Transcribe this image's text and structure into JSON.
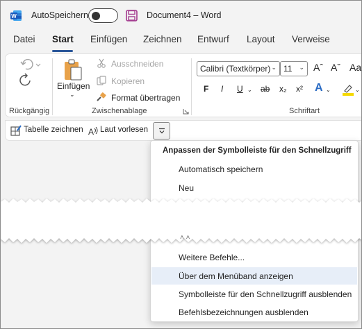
{
  "titlebar": {
    "autosave_label": "AutoSpeichern",
    "doc_title": "Document4 – Word"
  },
  "tabs": [
    {
      "label": "Datei"
    },
    {
      "label": "Start"
    },
    {
      "label": "Einfügen"
    },
    {
      "label": "Zeichnen"
    },
    {
      "label": "Entwurf"
    },
    {
      "label": "Layout"
    },
    {
      "label": "Verweise"
    }
  ],
  "ribbon": {
    "undo_group_label": "Rückgängig",
    "paste_label": "Einfügen",
    "cut_label": "Ausschneiden",
    "copy_label": "Kopieren",
    "format_painter_label": "Format übertragen",
    "clipboard_group_label": "Zwischenablage",
    "font_name": "Calibri (Textkörper)",
    "font_size": "11",
    "font_group_label": "Schriftart",
    "grow_font": "Aˆ",
    "shrink_font": "Aˇ",
    "change_case": "Aa",
    "bold": "F",
    "italic": "I",
    "underline": "U",
    "strikethrough": "ab",
    "subscript": "x₂",
    "superscript": "x²",
    "text_effects": "A"
  },
  "qat": {
    "draw_table_label": "Tabelle zeichnen",
    "read_aloud_label": "Laut vorlesen"
  },
  "menu": {
    "header": "Anpassen der Symbolleiste für den Schnellzugriff",
    "items_top": [
      {
        "label": "Automatisch speichern"
      },
      {
        "label": "Neu"
      }
    ],
    "items_bottom": [
      {
        "label": "Weitere Befehle..."
      },
      {
        "label": "Über dem Menüband anzeigen"
      },
      {
        "label": "Symbolleiste für den Schnellzugriff ausblenden"
      },
      {
        "label": "Befehlsbezeichnungen ausblenden"
      }
    ]
  },
  "colors": {
    "accent": "#2b579a",
    "save_icon": "#a33b8f",
    "highlight": "#e7eef8",
    "paste_icon": "#e8a24a",
    "text_effects": "#2b6cc4",
    "highlighter": "#f5d900"
  },
  "icons": [
    "word-icon",
    "save-icon",
    "undo-icon",
    "redo-icon",
    "paste-icon",
    "cut-icon",
    "copy-icon",
    "format-painter-icon",
    "dialog-launcher-icon",
    "draw-table-icon",
    "read-aloud-icon",
    "qat-dropdown-icon"
  ]
}
